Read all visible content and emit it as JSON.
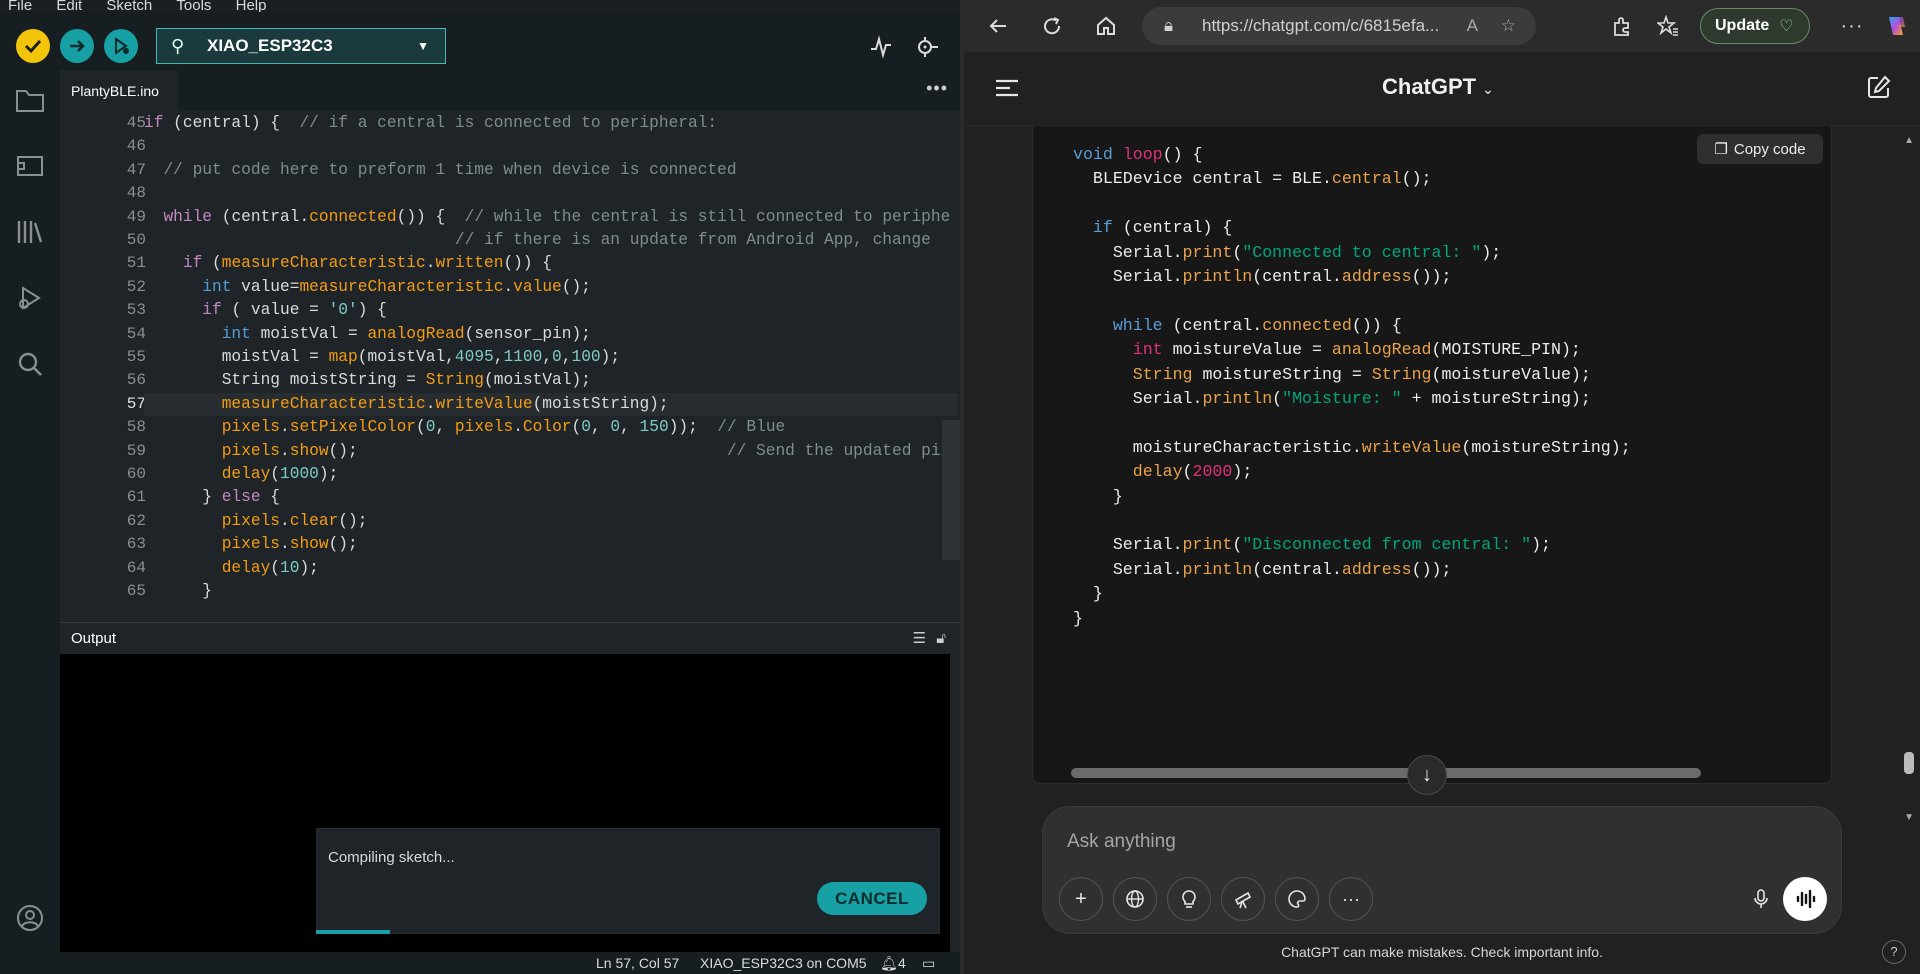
{
  "ide": {
    "menu": [
      "File",
      "Edit",
      "Sketch",
      "Tools",
      "Help"
    ],
    "board": "XIAO_ESP32C3",
    "tab": "PlantyBLE.ino",
    "lines": [
      {
        "n": "45",
        "t": "if (central) {  // if a central is connected to peripheral:"
      },
      {
        "n": "46",
        "t": ""
      },
      {
        "n": "47",
        "t": "  // put code here to preform 1 time when device is connected"
      },
      {
        "n": "48",
        "t": ""
      },
      {
        "n": "49",
        "t": "  while (central.connected()) {  // while the central is still connected to periphe"
      },
      {
        "n": "50",
        "t": "                                // if there is an update from Android App, change"
      },
      {
        "n": "51",
        "t": "    if (measureCharacteristic.written()) {"
      },
      {
        "n": "52",
        "t": "      int value=measureCharacteristic.value();"
      },
      {
        "n": "53",
        "t": "      if ( value = '0') {"
      },
      {
        "n": "54",
        "t": "        int moistVal = analogRead(sensor_pin);"
      },
      {
        "n": "55",
        "t": "        moistVal = map(moistVal,4095,1100,0,100);"
      },
      {
        "n": "56",
        "t": "        String moistString = String(moistVal);"
      },
      {
        "n": "57",
        "t": "        measureCharacteristic.writeValue(moistString);"
      },
      {
        "n": "58",
        "t": "        pixels.setPixelColor(0, pixels.Color(0, 0, 150));  // Blue"
      },
      {
        "n": "59",
        "t": "        pixels.show();                                      // Send the updated pixe"
      },
      {
        "n": "60",
        "t": "        delay(1000);"
      },
      {
        "n": "61",
        "t": "      } else {"
      },
      {
        "n": "62",
        "t": "        pixels.clear();"
      },
      {
        "n": "63",
        "t": "        pixels.show();"
      },
      {
        "n": "64",
        "t": "        delay(10);"
      },
      {
        "n": "65",
        "t": "      }"
      }
    ],
    "output_label": "Output",
    "compile_msg": "Compiling sketch...",
    "cancel_label": "CANCEL",
    "status": {
      "position": "Ln 57, Col 57",
      "port": "XIAO_ESP32C3 on COM5",
      "notifications": "4"
    },
    "colors": {
      "accent": "#17a1a5",
      "verify": "#f2c50a"
    }
  },
  "browser": {
    "url": "https://chatgpt.com/c/6815efa...",
    "update_label": "Update",
    "title": "ChatGPT",
    "copy_label": "Copy code",
    "code": [
      "void loop() {",
      "  BLEDevice central = BLE.central();",
      "",
      "  if (central) {",
      "    Serial.print(\"Connected to central: \");",
      "    Serial.println(central.address());",
      "",
      "    while (central.connected()) {",
      "      int moistureValue = analogRead(MOISTURE_PIN);",
      "      String moistureString = String(moistureValue);",
      "      Serial.println(\"Moisture: \" + moistureString);",
      "",
      "      moistureCharacteristic.writeValue(moistureString);",
      "      delay(2000);",
      "    }",
      "",
      "    Serial.print(\"Disconnected from central: \");",
      "    Serial.println(central.address());",
      "  }",
      "}"
    ],
    "placeholder": "Ask anything",
    "disclaimer": "ChatGPT can make mistakes. Check important info.",
    "help": "?"
  }
}
